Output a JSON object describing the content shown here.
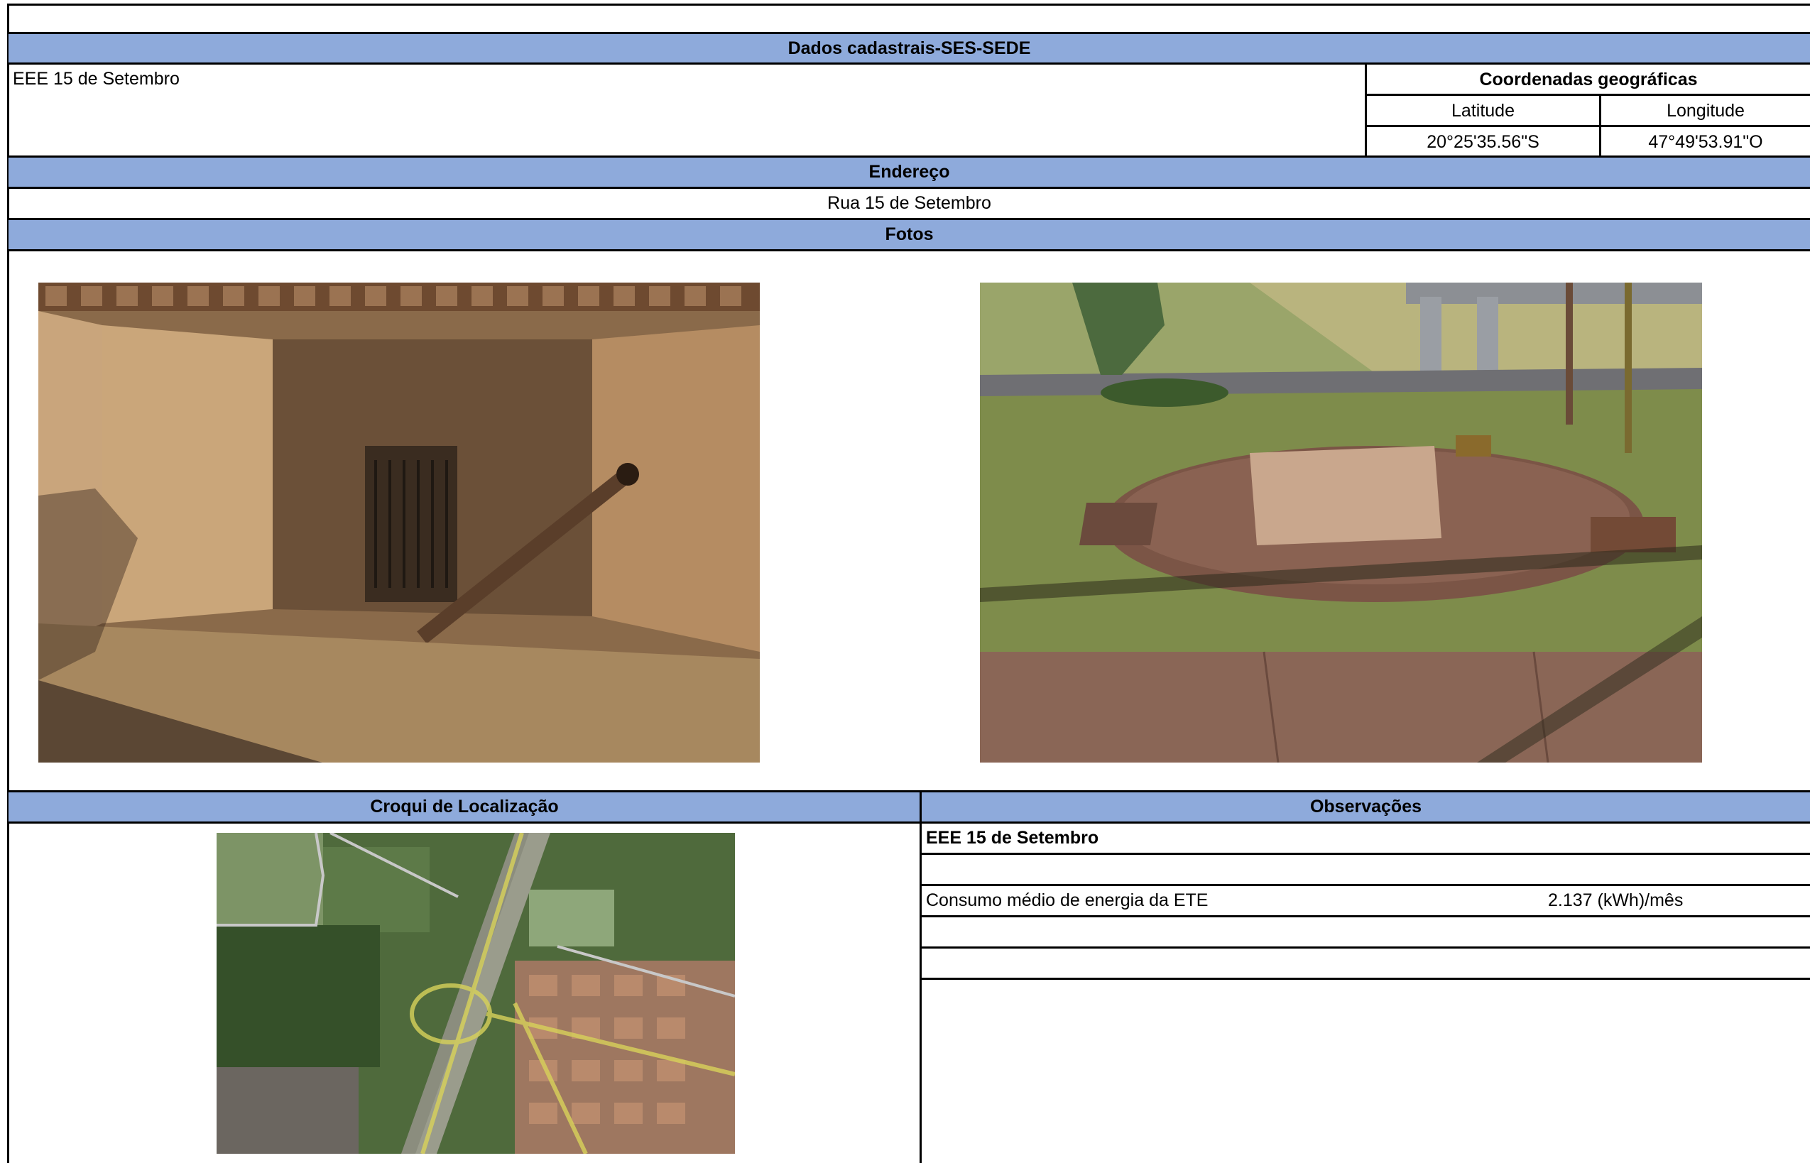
{
  "title_bar": "Dados cadastrais-SES-SEDE",
  "station_name": "EEE 15 de Setembro",
  "coords": {
    "header": "Coordenadas geográficas",
    "lat_label": "Latitude",
    "lon_label": "Longitude",
    "lat_value": "20°25'35.56\"S",
    "lon_value": "47°49'53.91\"O"
  },
  "address": {
    "header": "Endereço",
    "value": "Rua 15 de Setembro"
  },
  "photos": {
    "header": "Fotos"
  },
  "croqui": {
    "header": "Croqui de Localização"
  },
  "observacoes": {
    "header": "Observações",
    "title": "EEE 15 de Setembro",
    "energy_label": "Consumo médio de energia da ETE",
    "energy_value": "2.137 (kWh)/mês"
  }
}
